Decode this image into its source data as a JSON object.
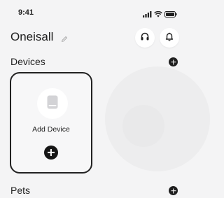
{
  "status_bar": {
    "time": "9:41",
    "icons": [
      "signal-icon",
      "wifi-icon",
      "battery-icon"
    ]
  },
  "header": {
    "title": "Oneisall",
    "edit_icon": "pencil-icon",
    "buttons": [
      "headphones-icon",
      "bell-icon"
    ]
  },
  "devices_section": {
    "title": "Devices",
    "add_icon": "plus-icon",
    "card": {
      "icon": "device-icon",
      "label": "Add Device",
      "add_icon": "plus-icon"
    }
  },
  "pets_section": {
    "title": "Pets",
    "add_icon": "plus-icon"
  },
  "colors": {
    "background": "#f4f4f5",
    "text": "#1f1f1f",
    "accent": "#161616"
  }
}
